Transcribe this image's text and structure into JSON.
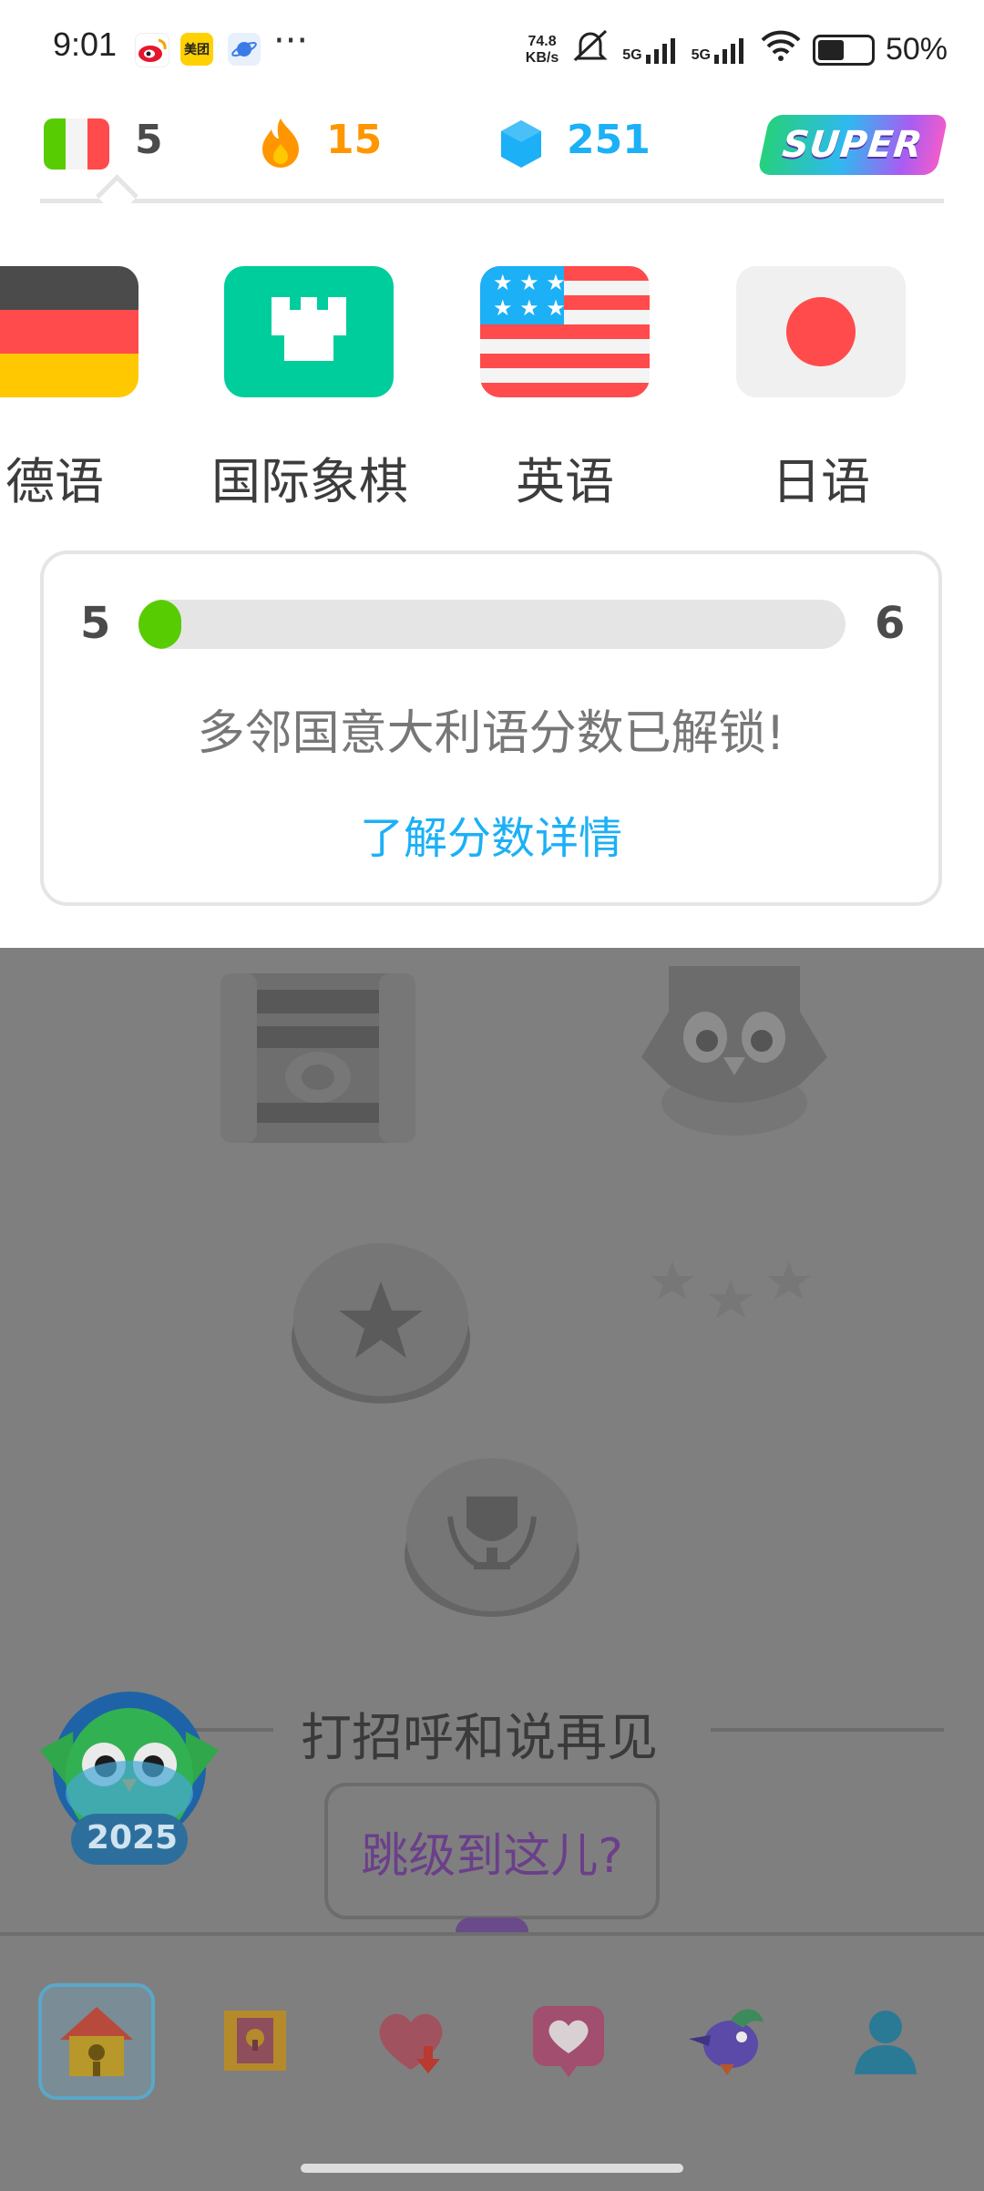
{
  "status_bar": {
    "time": "9:01",
    "apps": [
      {
        "name": "weibo-icon",
        "label": ""
      },
      {
        "name": "meituan-icon",
        "label": "美团"
      },
      {
        "name": "planet-icon",
        "label": ""
      }
    ],
    "more": "···",
    "net_speed_value": "74.8",
    "net_speed_unit": "KB/s",
    "signal_1_label": "5G",
    "signal_2_label": "5G",
    "battery_percent": "50%"
  },
  "top_stats": {
    "language_level": "5",
    "streak": "15",
    "gems": "251",
    "super_label": "SUPER",
    "colors": {
      "streak": "#ff9600",
      "gems": "#1cb0f6"
    }
  },
  "courses": [
    {
      "label": "德语",
      "icon": "germany-flag-icon"
    },
    {
      "label": "国际象棋",
      "icon": "chess-rook-icon"
    },
    {
      "label": "英语",
      "icon": "usa-flag-icon"
    },
    {
      "label": "日语",
      "icon": "japan-flag-icon"
    }
  ],
  "score_card": {
    "from": "5",
    "to": "6",
    "progress_fraction": 0.06,
    "message": "多邻国意大利语分数已解锁!",
    "link": "了解分数详情",
    "colors": {
      "progress": "#58cc02",
      "link": "#1cb0f6"
    }
  },
  "path": {
    "section_title": "打招呼和说再见",
    "jump_prompt": "跳级到这儿?",
    "year_badge": "2025"
  },
  "bottom_nav": [
    {
      "name": "nav-home",
      "icon": "house-icon",
      "active": true
    },
    {
      "name": "nav-chest",
      "icon": "treasure-chest-icon",
      "active": false
    },
    {
      "name": "nav-hearts-download",
      "icon": "heart-download-icon",
      "active": false
    },
    {
      "name": "nav-health",
      "icon": "heart-icon",
      "active": false
    },
    {
      "name": "nav-practice",
      "icon": "bird-icon",
      "active": false
    },
    {
      "name": "nav-profile",
      "icon": "profile-icon",
      "active": false
    }
  ]
}
